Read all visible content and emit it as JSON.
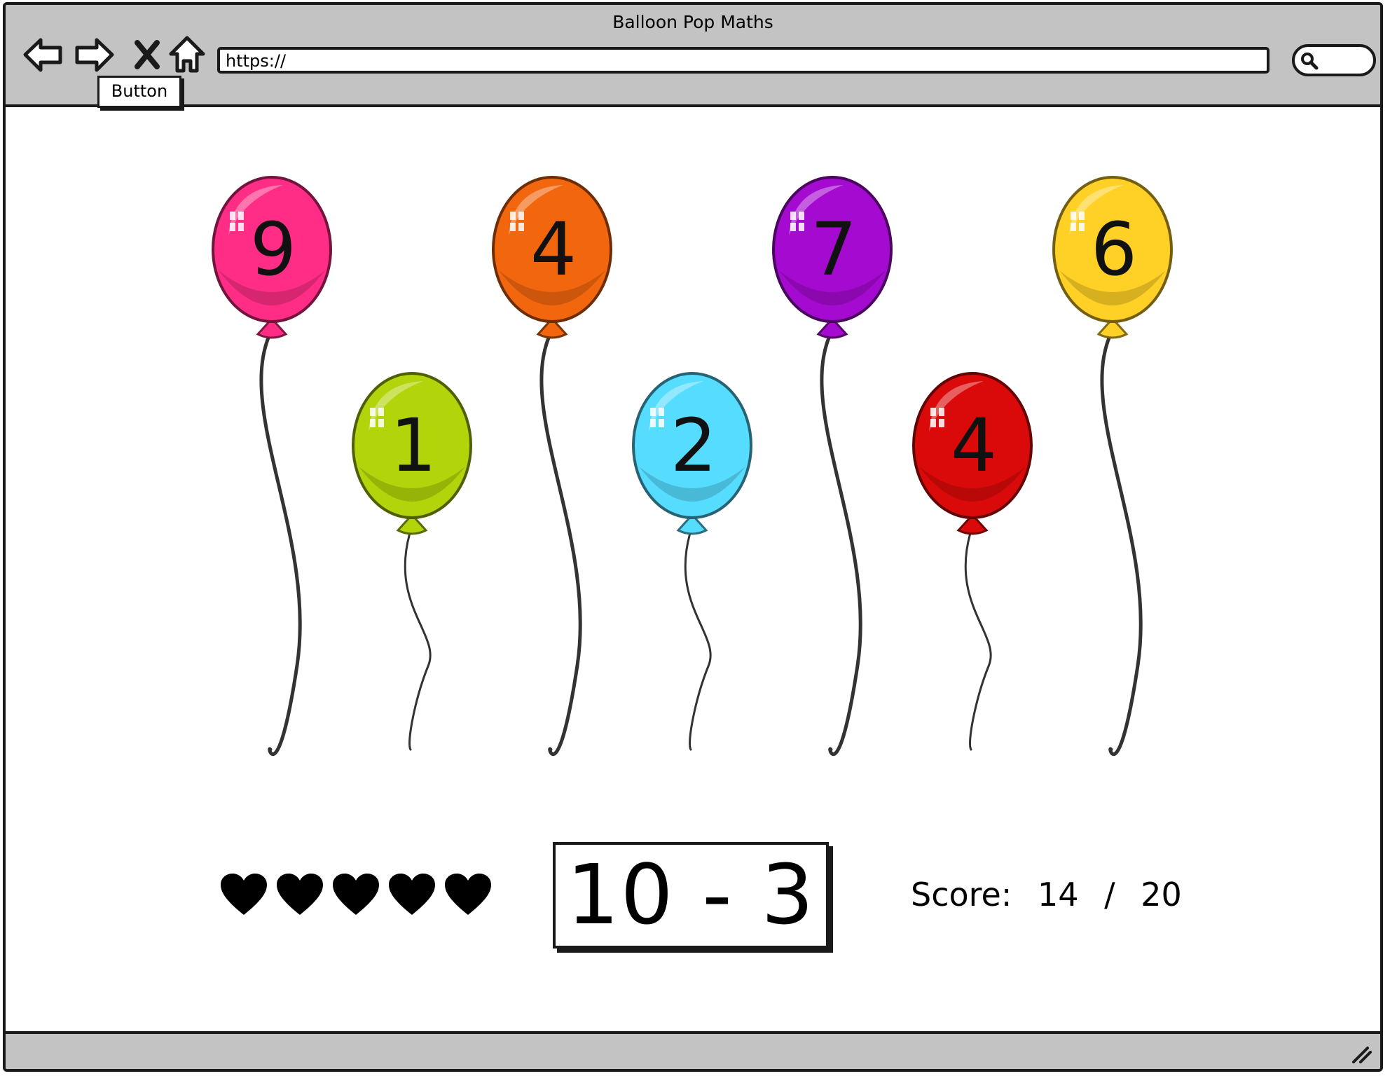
{
  "window": {
    "title": "Balloon Pop Maths"
  },
  "toolbar": {
    "back_icon": "arrow-left-icon",
    "forward_icon": "arrow-right-icon",
    "stop_icon": "x-icon",
    "home_icon": "home-icon",
    "url": "https://",
    "search_icon": "magnifier-icon",
    "tooltip": "Button"
  },
  "balloons": [
    {
      "number": "9",
      "color": "#ff2d85"
    },
    {
      "number": "1",
      "color": "#b2d40a"
    },
    {
      "number": "4",
      "color": "#f2660e"
    },
    {
      "number": "2",
      "color": "#56dcff"
    },
    {
      "number": "7",
      "color": "#a50ad0"
    },
    {
      "number": "4",
      "color": "#db0a0a"
    },
    {
      "number": "6",
      "color": "#ffd126"
    }
  ],
  "game": {
    "lives": 5,
    "problem": "10 - 3",
    "score_label": "Score:",
    "score_value": "14",
    "score_separator": "/",
    "score_total": "20"
  },
  "colors": {
    "chrome": "#c3c3c3",
    "outline": "#1a1a1a",
    "heart": "#000000"
  }
}
